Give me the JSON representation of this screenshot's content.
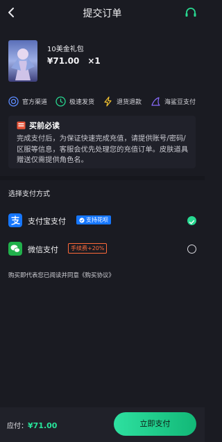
{
  "header": {
    "title": "提交订单"
  },
  "product": {
    "name": "10美金礼包",
    "price": "¥71.00",
    "quantity": "×1"
  },
  "features": [
    {
      "label": "官方渠道",
      "icon": "official-channel-icon"
    },
    {
      "label": "极速发货",
      "icon": "fast-delivery-icon"
    },
    {
      "label": "退货退款",
      "icon": "refund-icon"
    },
    {
      "label": "海鲨豆支付",
      "icon": "beans-pay-icon"
    }
  ],
  "notice": {
    "title": "买前必读",
    "body": "完成支付后，为保证快速完成充值，请提供账号/密码/区服等信息，客服会优先处理您的充值订单。皮肤道具赠送仅需提供角色名。"
  },
  "payment": {
    "section_title": "选择支付方式",
    "methods": [
      {
        "name": "支付宝支付",
        "badge": "支持花呗",
        "selected": true,
        "icon": "alipay-icon"
      },
      {
        "name": "微信支付",
        "badge": "手续费+20%",
        "selected": false,
        "icon": "wechat-pay-icon"
      }
    ]
  },
  "agreement": "购买即代表您已阅读并同意《购买协议》",
  "footer": {
    "total_label": "应付：",
    "total_value": "¥71.00",
    "pay_button": "立即支付"
  },
  "colors": {
    "accent": "#28d891",
    "alipay": "#1677ff",
    "wechat": "#21b04b",
    "warning": "#ff6a3a"
  }
}
